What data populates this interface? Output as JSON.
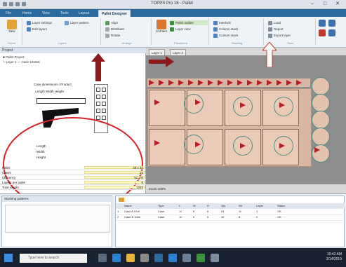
{
  "title_bar": {
    "title": "TOPPS Pro 16 - Pallet"
  },
  "window": {
    "min": "–",
    "max": "□",
    "close": "✕"
  },
  "tabs": [
    "File",
    "Home",
    "View",
    "Tools",
    "Layout",
    "Pallet Designer"
  ],
  "active_tab": 5,
  "ribbon": {
    "groups": [
      {
        "label": "Home",
        "items": [
          "New",
          "Open"
        ]
      },
      {
        "label": "Layers",
        "items": [
          "Layer settings",
          "Edit layers",
          "Layer pattern"
        ]
      },
      {
        "label": "Arrange",
        "items": [
          "Align",
          "Distribute",
          "Rotate"
        ]
      },
      {
        "label": "Placement",
        "items": [
          "Corners",
          "Pallet outline",
          "Layer view"
        ]
      },
      {
        "label": "Stacking",
        "items": [
          "Interlock",
          "Column stack",
          "Custom stack"
        ]
      },
      {
        "label": "Tools",
        "items": [
          "Load",
          "Report",
          "Export layer"
        ]
      }
    ]
  },
  "left_panel": {
    "header": "Project",
    "tree": [
      "■ Pallet Project",
      "  └ Layer 1 — Case 12x8x6"
    ],
    "dialog_title": "Case dimensions / Product",
    "dialog_sub": "Length  Width  Height",
    "fields": [
      "Length",
      "Width",
      "Height"
    ],
    "props": [
      {
        "key": "Pallet",
        "value": "48 x 40"
      },
      {
        "key": "Cases",
        "value": "24"
      },
      {
        "key": "Efficiency",
        "value": "91.2%"
      },
      {
        "key": "Layers per pallet",
        "value": "6"
      },
      {
        "key": "Total weight",
        "value": "1240"
      }
    ]
  },
  "canvas": {
    "tabs": [
      "Layer 1",
      "Layer 2"
    ],
    "status": "Zoom 100%"
  },
  "bottom": {
    "left_header": "Stacking patterns",
    "grid_headers": [
      "",
      "Name",
      "Type",
      "L",
      "W",
      "H",
      "Qty",
      "Wt",
      "Layer",
      "Status"
    ],
    "rows": [
      [
        "1",
        "Case A 12x8",
        "Case",
        "12",
        "8",
        "6",
        "24",
        "10",
        "1",
        "OK"
      ],
      [
        "2",
        "Case B 10x6",
        "Case",
        "10",
        "6",
        "6",
        "18",
        "8",
        "2",
        "OK"
      ]
    ]
  },
  "taskbar": {
    "search_placeholder": "Type here to search",
    "time": "10:42 AM",
    "date": "3/14/2019"
  },
  "colors": {
    "ribbon_tab_bg": "#2c6a9e",
    "canvas_bg": "#919191",
    "pallet_fill": "#e9cbb7",
    "arrow_red": "#8b1a1a",
    "highlight_ellipse": "#d8222a"
  }
}
